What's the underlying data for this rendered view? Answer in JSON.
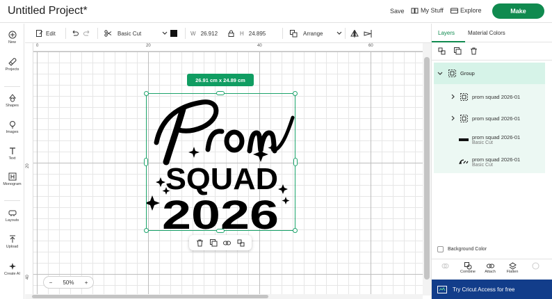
{
  "header": {
    "title": "Untitled Project*",
    "save": "Save",
    "my_stuff": "My Stuff",
    "explore": "Explore",
    "make": "Make"
  },
  "left_toolbar": {
    "items": [
      {
        "label": "New",
        "icon": "plus-circle-icon"
      },
      {
        "label": "Projects",
        "icon": "rocket-icon"
      },
      {
        "label": "Shapes",
        "icon": "shapes-icon"
      },
      {
        "label": "Images",
        "icon": "lightbulb-icon"
      },
      {
        "label": "Text",
        "icon": "text-icon"
      },
      {
        "label": "Monogram",
        "icon": "monogram-icon"
      },
      {
        "label": "Layouts",
        "icon": "layouts-icon"
      },
      {
        "label": "Upload",
        "icon": "upload-icon"
      },
      {
        "label": "Create AI",
        "icon": "sparkle-icon"
      }
    ]
  },
  "edit_toolbar": {
    "edit": "Edit",
    "operation": "Basic Cut",
    "width_label": "W",
    "width_value": "26.912",
    "height_label": "H",
    "height_value": "24.895",
    "arrange": "Arrange",
    "swatch_color": "#111111"
  },
  "ruler": {
    "top": [
      "0",
      "20",
      "40",
      "60"
    ],
    "left": [
      "20",
      "40"
    ]
  },
  "canvas": {
    "size_tag": "26.91  cm x 24.89  cm",
    "zoom": "50%",
    "zoom_minus": "−",
    "zoom_plus": "+",
    "accent": "#1aa36a"
  },
  "right_panel": {
    "tabs": [
      "Layers",
      "Material Colors"
    ],
    "group": "Group",
    "layers": [
      {
        "name": "prom squad 2026-01",
        "sub": "",
        "icon": "group-icon"
      },
      {
        "name": "prom squad 2026-01",
        "sub": "",
        "icon": "group-icon"
      },
      {
        "name": "prom squad 2026-01",
        "sub": "Basic Cut",
        "icon": "thumb-squad-icon"
      },
      {
        "name": "prom squad 2026-01",
        "sub": "Basic Cut",
        "icon": "thumb-prom-icon"
      }
    ],
    "background_color": "Background Color",
    "bottom_tools": [
      "Combine",
      "Attach",
      "Flatten"
    ],
    "access_banner": "Try Cricut Access for free",
    "brand_color": "#108a4f"
  }
}
